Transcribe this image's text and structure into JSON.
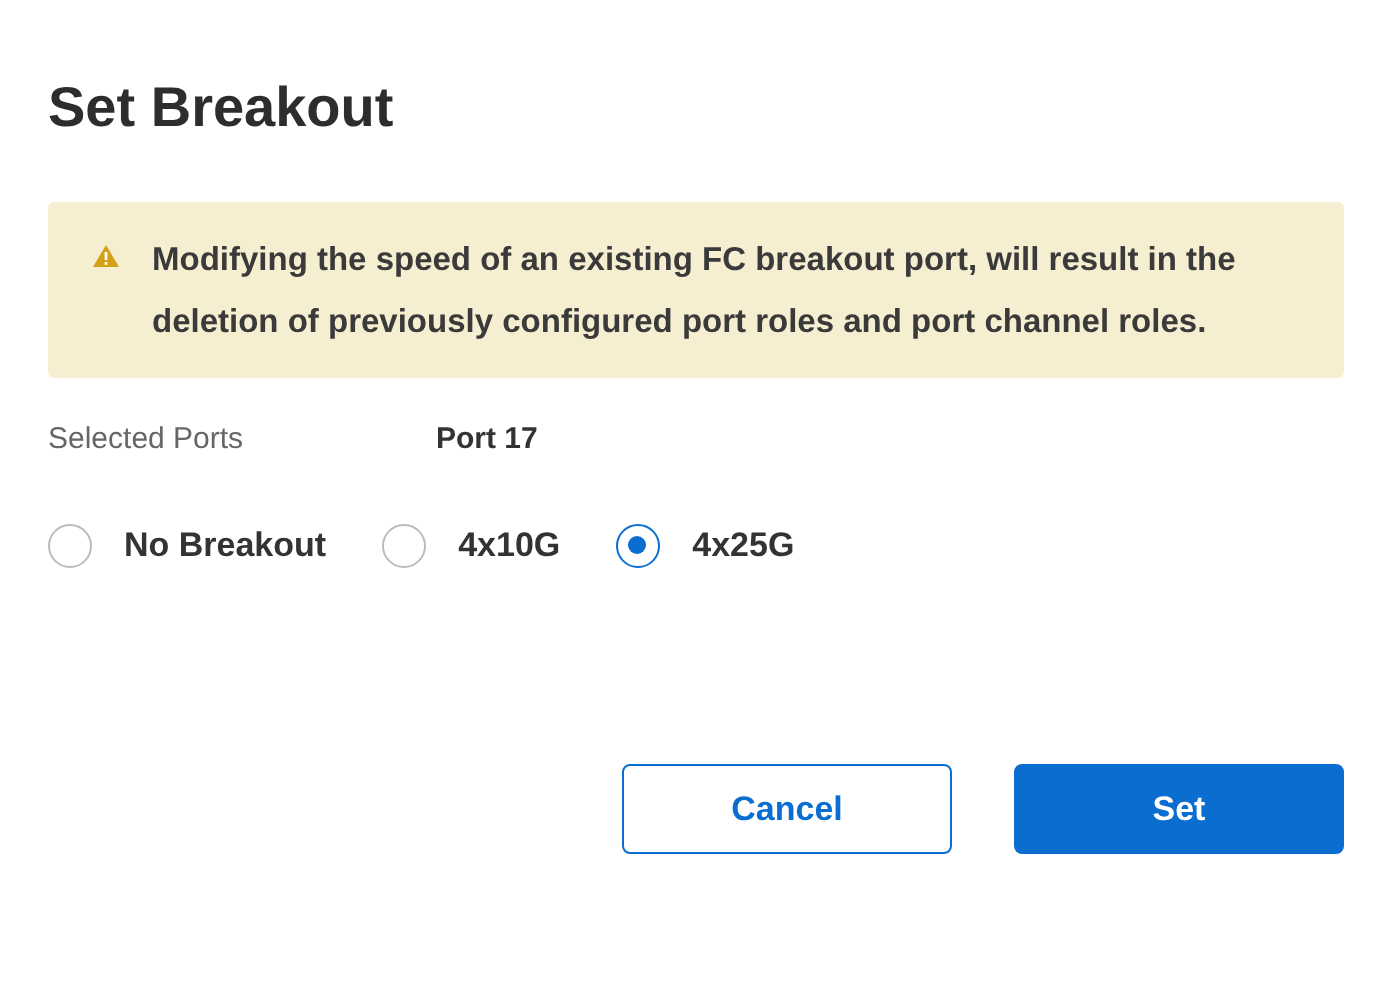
{
  "title": "Set Breakout",
  "warning": {
    "text": "Modifying the speed of an existing FC breakout port, will result in the deletion of previously configured port roles and port channel roles."
  },
  "selected_ports": {
    "label": "Selected Ports",
    "value": "Port 17"
  },
  "breakout_options": [
    {
      "label": "No Breakout",
      "selected": false
    },
    {
      "label": "4x10G",
      "selected": false
    },
    {
      "label": "4x25G",
      "selected": true
    }
  ],
  "buttons": [
    {
      "label": "Cancel",
      "kind": "secondary"
    },
    {
      "label": "Set",
      "kind": "primary"
    }
  ]
}
